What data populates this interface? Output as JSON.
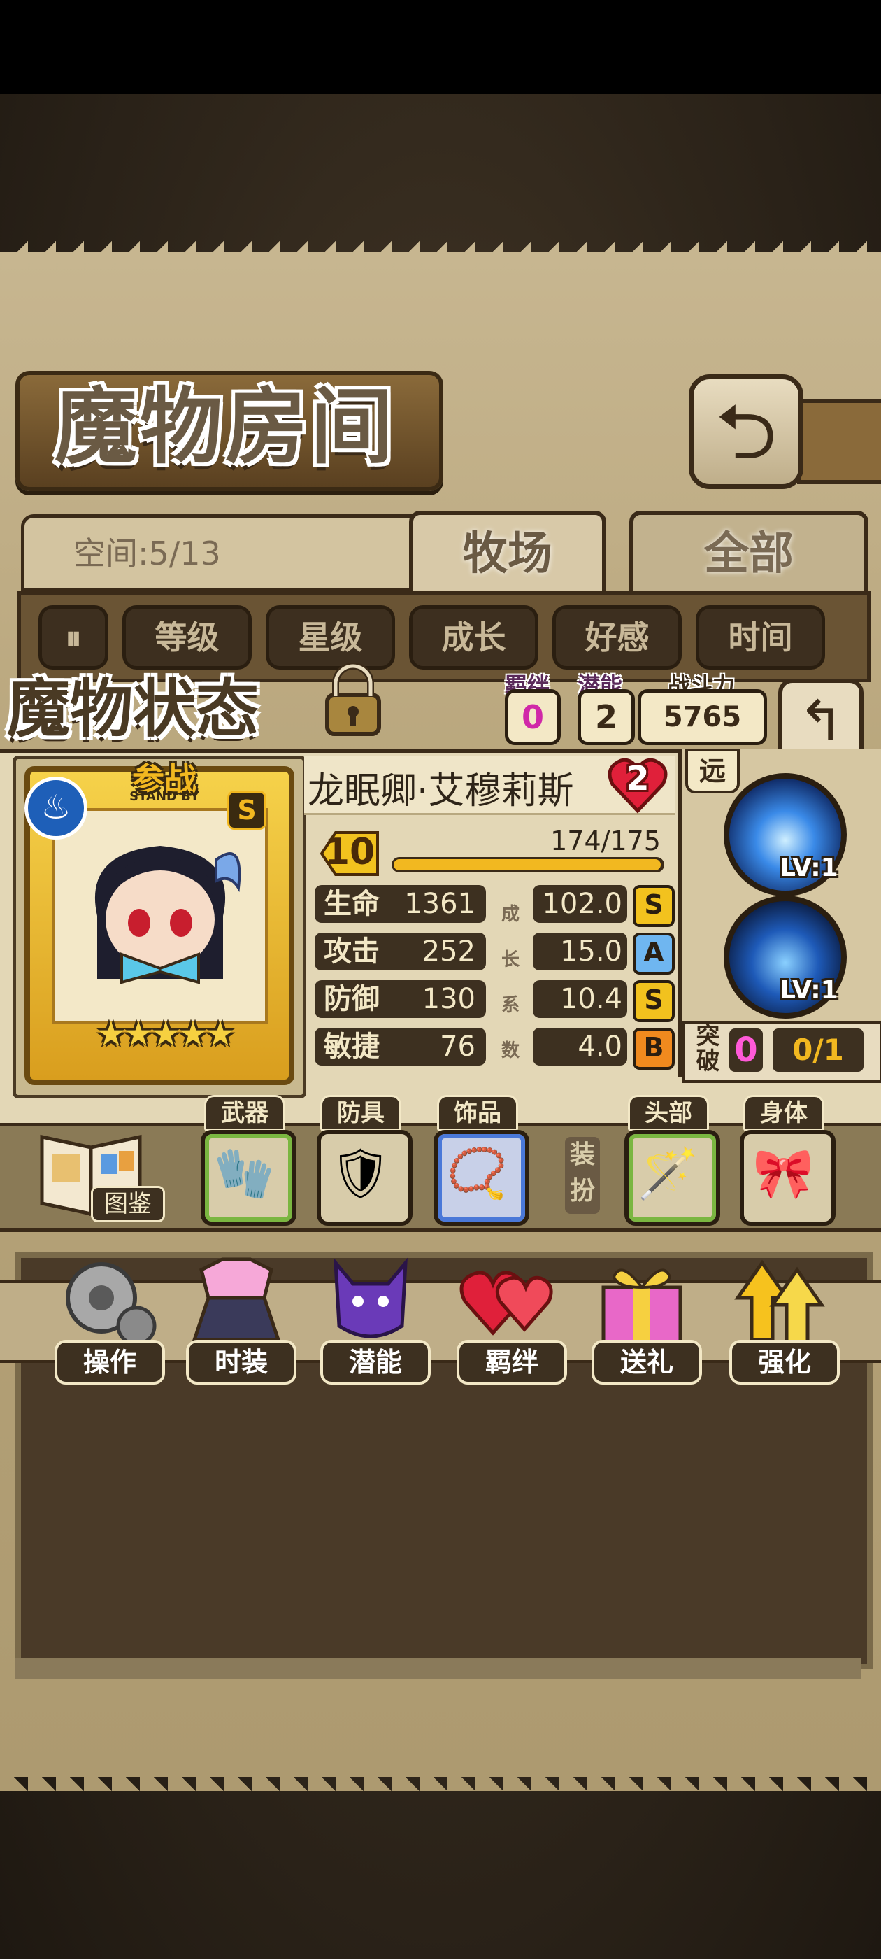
{
  "header": {
    "title": "魔物房间",
    "back_icon": "return-arrow-icon"
  },
  "space": {
    "label": "空间:5/13"
  },
  "tabs": [
    {
      "label": "牧场"
    },
    {
      "label": "全部"
    }
  ],
  "sort": {
    "toggle_icon": "pause-icon",
    "options": [
      "等级",
      "星级",
      "成长",
      "好感",
      "时间"
    ]
  },
  "status": {
    "title": "魔物状态",
    "bond_label": "羁绊",
    "bond_value": "0",
    "potential_label": "潜能",
    "potential_value": "2",
    "power_label": "战斗力",
    "power_value": "5765",
    "card_banner": "参战",
    "card_banner_sub": "STAND BY",
    "element_icon": "water-icon",
    "rank": "S",
    "stars": "★★★★★",
    "star_count": 5,
    "name": "龙眠卿·艾穆莉斯",
    "bond_level": "2",
    "level": "10",
    "exp_text": "174/175",
    "exp_fraction": 0.994,
    "stats": [
      {
        "label": "生命",
        "value": "1361",
        "growth": "102.0",
        "grade": "S"
      },
      {
        "label": "攻击",
        "value": "252",
        "growth": "15.0",
        "grade": "A"
      },
      {
        "label": "防御",
        "value": "130",
        "growth": "10.4",
        "grade": "S"
      },
      {
        "label": "敏捷",
        "value": "76",
        "growth": "4.0",
        "grade": "B"
      }
    ],
    "growth_label_chars": [
      "成",
      "长",
      "系",
      "数"
    ],
    "range": "远",
    "skills": [
      {
        "level": "LV:1"
      },
      {
        "level": "LV:1"
      }
    ],
    "breakthrough": {
      "label": "突破",
      "count": "0",
      "progress": "0/1"
    }
  },
  "equipment": {
    "book_label": "图鉴",
    "dress_label": "装扮",
    "slots": [
      {
        "label": "武器",
        "item_icon": "glove-icon"
      },
      {
        "label": "防具",
        "item_icon": "armor-icon"
      },
      {
        "label": "饰品",
        "item_icon": "necklace-icon"
      },
      {
        "label": "头部",
        "item_icon": "wand-icon"
      },
      {
        "label": "身体",
        "item_icon": "bow-icon"
      }
    ]
  },
  "actions": [
    {
      "label": "操作",
      "icon": "gear-icon"
    },
    {
      "label": "时装",
      "icon": "outfit-icon"
    },
    {
      "label": "潜能",
      "icon": "potential-icon"
    },
    {
      "label": "羁绊",
      "icon": "heart-icon"
    },
    {
      "label": "送礼",
      "icon": "gift-icon"
    },
    {
      "label": "强化",
      "icon": "upgrade-arrow-icon"
    }
  ]
}
